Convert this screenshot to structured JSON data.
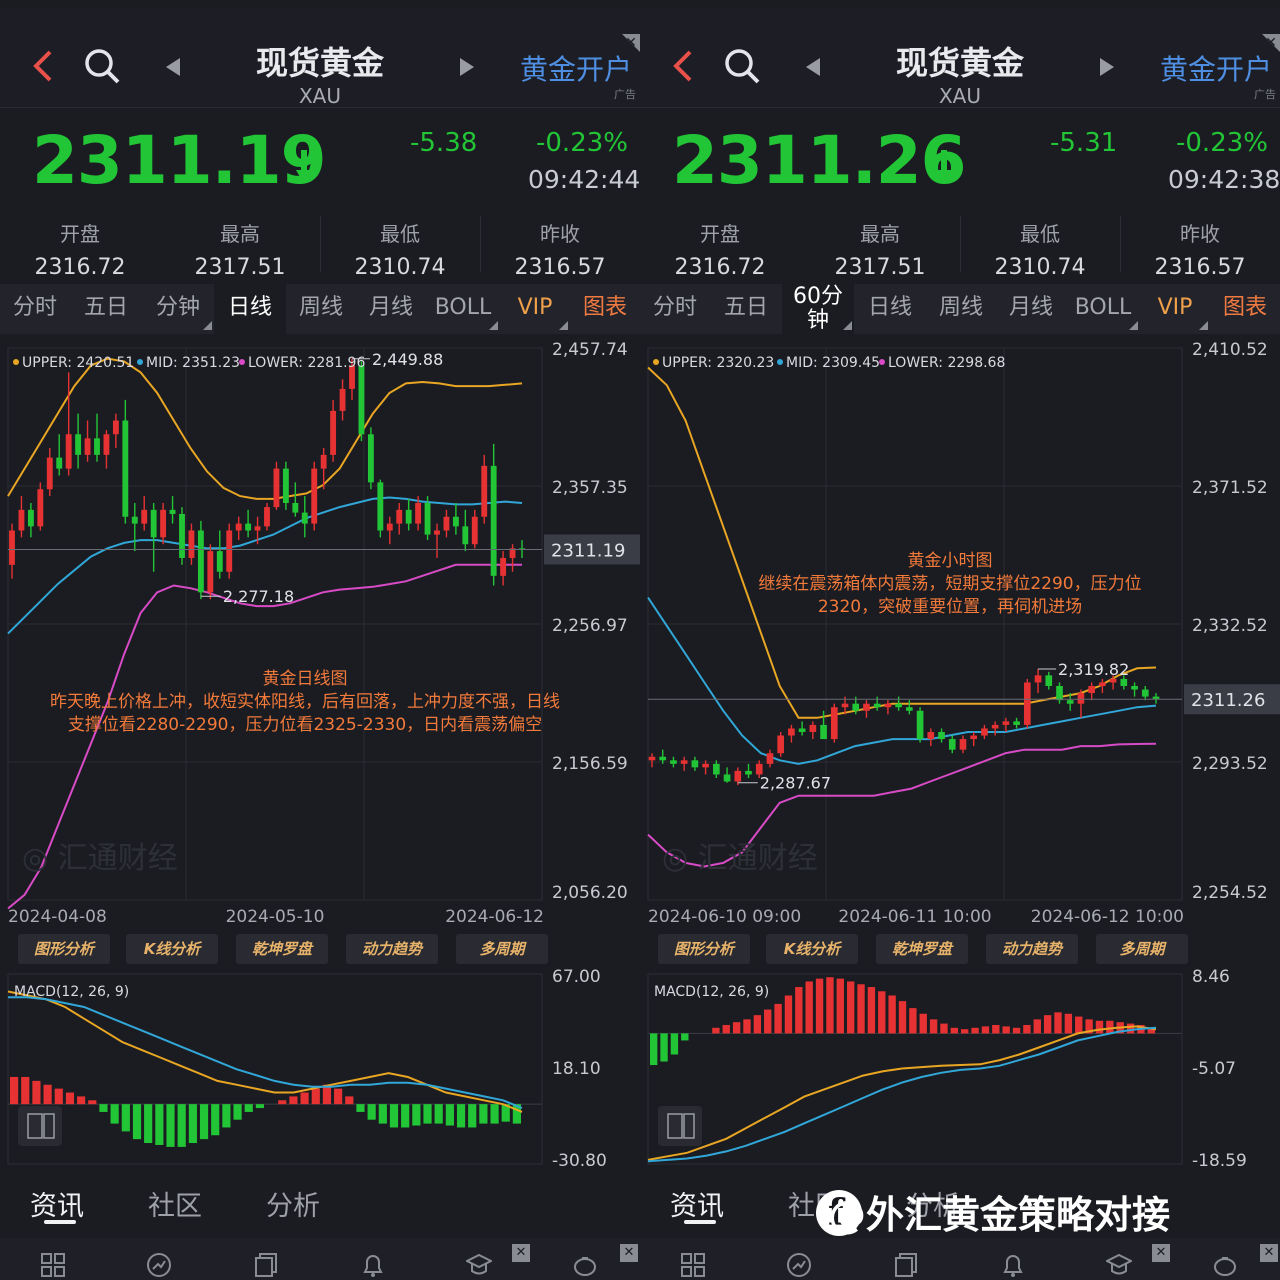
{
  "panels": [
    {
      "header": {
        "title": "现货黄金",
        "symbol": "XAU",
        "open_account": "黄金开户",
        "ad_tag": "广告",
        "close_glyph": "✕"
      },
      "quote": {
        "price": "2311.19",
        "change": "-5.38",
        "change_pct": "-0.23%",
        "time": "09:42:44"
      },
      "stats": [
        {
          "label": "开盘",
          "value": "2316.72"
        },
        {
          "label": "最高",
          "value": "2317.51"
        },
        {
          "label": "最低",
          "value": "2310.74"
        },
        {
          "label": "昨收",
          "value": "2316.57"
        }
      ],
      "tabs": [
        "分时",
        "五日",
        "分钟",
        "日线",
        "周线",
        "月线",
        "BOLL",
        "VIP",
        "图表"
      ],
      "active_tab": "日线",
      "indicator_buttons": [
        "图形分析",
        "K线分析",
        "乾坤罗盘",
        "动力趋势",
        "多周期"
      ],
      "nav": [
        "资讯",
        "社区",
        "分析"
      ],
      "annotation": {
        "title": "黄金日线图",
        "lines": [
          "昨天晚上价格上冲，收短实体阳线，后有回落，上冲力度不强，日线",
          "支撑位看2280-2290，压力位看2325-2330，日内看震荡偏空"
        ]
      },
      "watermark_text": "汇通财经"
    },
    {
      "header": {
        "title": "现货黄金",
        "symbol": "XAU",
        "open_account": "黄金开户",
        "ad_tag": "广告",
        "close_glyph": "✕"
      },
      "quote": {
        "price": "2311.26",
        "change": "-5.31",
        "change_pct": "-0.23%",
        "time": "09:42:38"
      },
      "stats": [
        {
          "label": "开盘",
          "value": "2316.72"
        },
        {
          "label": "最高",
          "value": "2317.51"
        },
        {
          "label": "最低",
          "value": "2310.74"
        },
        {
          "label": "昨收",
          "value": "2316.57"
        }
      ],
      "tabs": [
        "分时",
        "五日",
        "60分钟",
        "日线",
        "周线",
        "月线",
        "BOLL",
        "VIP",
        "图表"
      ],
      "tab_60_line1": "60分",
      "tab_60_line2": "钟",
      "active_tab": "60分钟",
      "indicator_buttons": [
        "图形分析",
        "K线分析",
        "乾坤罗盘",
        "动力趋势",
        "多周期"
      ],
      "nav": [
        "资讯",
        "社区",
        "分析"
      ],
      "annotation": {
        "title": "黄金小时图",
        "lines": [
          "继续在震荡箱体内震荡，短期支撑位2290，压力位",
          "2320，突破重要位置，再伺机进场"
        ]
      },
      "watermark_text": "汇通财经"
    }
  ],
  "footer_watermark": "@外汇黄金策略对接",
  "colors": {
    "up": "#e63232",
    "down": "#22c536",
    "upper": "#e8a623",
    "mid": "#31a7d8",
    "lower": "#d84bc6",
    "annotation": "#f27a3a",
    "link": "#4e8fe3"
  },
  "dock_icons": [
    "grid-icon",
    "compass-icon",
    "news-icon",
    "bell-icon",
    "mortarboard-icon",
    "piggy-bank-icon"
  ],
  "chart_data": [
    {
      "type": "candlestick",
      "title": "",
      "indicator": "BOLL",
      "legend": {
        "upper": "UPPER: 2420.51",
        "mid": "MID: 2351.23",
        "lower": "LOWER: 2281.96"
      },
      "y_ticks": [
        "2,457.74",
        "2,357.35",
        "2,256.97",
        "2,156.59",
        "2,056.20"
      ],
      "ylim": [
        2056.2,
        2457.74
      ],
      "x_ticks": [
        "2024-04-08",
        "2024-05-10",
        "2024-06-12"
      ],
      "current_price_label": "2311.19",
      "current_price": 2311.19,
      "high_label": "2,449.88",
      "high": 2449.88,
      "low_label": "2,277.18",
      "low": 2277.18,
      "ohlc": [
        [
          2300,
          2330,
          2290,
          2325
        ],
        [
          2325,
          2350,
          2320,
          2340
        ],
        [
          2340,
          2345,
          2320,
          2328
        ],
        [
          2328,
          2360,
          2325,
          2355
        ],
        [
          2355,
          2385,
          2350,
          2378
        ],
        [
          2378,
          2395,
          2365,
          2370
        ],
        [
          2370,
          2440,
          2365,
          2395
        ],
        [
          2395,
          2410,
          2370,
          2380
        ],
        [
          2380,
          2405,
          2375,
          2392
        ],
        [
          2392,
          2410,
          2375,
          2380
        ],
        [
          2380,
          2398,
          2370,
          2395
        ],
        [
          2395,
          2410,
          2385,
          2405
        ],
        [
          2405,
          2420,
          2330,
          2335
        ],
        [
          2335,
          2345,
          2310,
          2330
        ],
        [
          2330,
          2350,
          2325,
          2340
        ],
        [
          2340,
          2345,
          2295,
          2320
        ],
        [
          2320,
          2345,
          2315,
          2340
        ],
        [
          2340,
          2350,
          2330,
          2337
        ],
        [
          2337,
          2342,
          2300,
          2305
        ],
        [
          2305,
          2330,
          2300,
          2325
        ],
        [
          2325,
          2332,
          2275,
          2280
        ],
        [
          2280,
          2315,
          2275,
          2310
        ],
        [
          2310,
          2325,
          2290,
          2295
        ],
        [
          2295,
          2330,
          2290,
          2325
        ],
        [
          2325,
          2335,
          2318,
          2330
        ],
        [
          2330,
          2340,
          2320,
          2325
        ],
        [
          2325,
          2335,
          2315,
          2328
        ],
        [
          2328,
          2345,
          2325,
          2342
        ],
        [
          2342,
          2375,
          2340,
          2370
        ],
        [
          2370,
          2375,
          2340,
          2345
        ],
        [
          2345,
          2360,
          2335,
          2338
        ],
        [
          2338,
          2350,
          2320,
          2330
        ],
        [
          2330,
          2375,
          2325,
          2370
        ],
        [
          2370,
          2385,
          2355,
          2380
        ],
        [
          2380,
          2420,
          2375,
          2412
        ],
        [
          2412,
          2435,
          2405,
          2428
        ],
        [
          2428,
          2450,
          2420,
          2445
        ],
        [
          2445,
          2448,
          2390,
          2395
        ],
        [
          2395,
          2400,
          2355,
          2360
        ],
        [
          2360,
          2362,
          2320,
          2325
        ],
        [
          2325,
          2335,
          2315,
          2330
        ],
        [
          2330,
          2345,
          2322,
          2340
        ],
        [
          2340,
          2348,
          2325,
          2330
        ],
        [
          2330,
          2350,
          2325,
          2345
        ],
        [
          2345,
          2350,
          2318,
          2322
        ],
        [
          2322,
          2330,
          2305,
          2325
        ],
        [
          2325,
          2340,
          2320,
          2335
        ],
        [
          2335,
          2345,
          2322,
          2328
        ],
        [
          2328,
          2340,
          2310,
          2315
        ],
        [
          2315,
          2340,
          2312,
          2335
        ],
        [
          2335,
          2380,
          2330,
          2372
        ],
        [
          2372,
          2388,
          2285,
          2292
        ],
        [
          2292,
          2310,
          2285,
          2305
        ],
        [
          2305,
          2315,
          2295,
          2312
        ],
        [
          2312,
          2318,
          2305,
          2311
        ]
      ],
      "boll_upper": [
        2350,
        2370,
        2390,
        2410,
        2430,
        2445,
        2450,
        2448,
        2440,
        2425,
        2405,
        2385,
        2368,
        2356,
        2350,
        2348,
        2348,
        2350,
        2352,
        2358,
        2370,
        2390,
        2410,
        2425,
        2432,
        2433,
        2432,
        2430,
        2430,
        2430,
        2431,
        2432
      ],
      "boll_mid": [
        2250,
        2262,
        2274,
        2286,
        2296,
        2306,
        2312,
        2316,
        2318,
        2318,
        2316,
        2314,
        2312,
        2312,
        2314,
        2318,
        2322,
        2328,
        2334,
        2338,
        2342,
        2345,
        2348,
        2349,
        2348,
        2346,
        2345,
        2344,
        2344,
        2345,
        2346,
        2345
      ],
      "boll_lower": [
        2050,
        2060,
        2080,
        2110,
        2140,
        2170,
        2200,
        2235,
        2265,
        2280,
        2285,
        2283,
        2280,
        2276,
        2272,
        2270,
        2270,
        2272,
        2276,
        2280,
        2282,
        2283,
        2284,
        2286,
        2288,
        2292,
        2296,
        2300,
        2300,
        2300,
        2300,
        2300
      ]
    },
    {
      "type": "candlestick",
      "title": "",
      "indicator": "BOLL",
      "legend": {
        "upper": "UPPER: 2320.23",
        "mid": "MID: 2309.45",
        "lower": "LOWER: 2298.68"
      },
      "y_ticks": [
        "2,410.52",
        "2,371.52",
        "2,332.52",
        "2,293.52",
        "2,254.52"
      ],
      "ylim": [
        2254.52,
        2410.52
      ],
      "x_ticks": [
        "2024-06-10 09:00",
        "2024-06-11 10:00",
        "2024-06-12 10:00"
      ],
      "current_price_label": "2311.26",
      "current_price": 2311.26,
      "high_label": "2,319.82",
      "high": 2319.82,
      "low_label": "2,287.67",
      "low": 2287.67,
      "ohlc": [
        [
          2294,
          2296,
          2292,
          2295
        ],
        [
          2295,
          2297,
          2293,
          2294
        ],
        [
          2294,
          2295,
          2292,
          2293
        ],
        [
          2293,
          2295,
          2291,
          2294
        ],
        [
          2294,
          2295,
          2291,
          2292
        ],
        [
          2292,
          2294,
          2290,
          2293
        ],
        [
          2293,
          2294,
          2289,
          2290
        ],
        [
          2290,
          2292,
          2287.67,
          2288
        ],
        [
          2288,
          2292,
          2287,
          2291
        ],
        [
          2291,
          2293,
          2289,
          2290
        ],
        [
          2290,
          2294,
          2289,
          2293
        ],
        [
          2293,
          2297,
          2292,
          2296
        ],
        [
          2296,
          2302,
          2295,
          2301
        ],
        [
          2301,
          2304,
          2299,
          2303
        ],
        [
          2303,
          2305,
          2301,
          2302
        ],
        [
          2302,
          2305,
          2300,
          2304
        ],
        [
          2304,
          2308,
          2303,
          2300
        ],
        [
          2300,
          2310,
          2299,
          2309
        ],
        [
          2309,
          2312,
          2307,
          2310
        ],
        [
          2310,
          2312,
          2307,
          2308
        ],
        [
          2308,
          2311,
          2306,
          2310
        ],
        [
          2310,
          2312,
          2308,
          2309
        ],
        [
          2309,
          2311,
          2307,
          2310
        ],
        [
          2310,
          2312,
          2308,
          2309
        ],
        [
          2309,
          2311,
          2307,
          2308
        ],
        [
          2308,
          2309,
          2299,
          2300
        ],
        [
          2300,
          2303,
          2298,
          2302
        ],
        [
          2302,
          2303,
          2299,
          2300
        ],
        [
          2300,
          2301,
          2296,
          2297
        ],
        [
          2297,
          2301,
          2296,
          2300
        ],
        [
          2300,
          2302,
          2298,
          2301
        ],
        [
          2301,
          2304,
          2300,
          2303
        ],
        [
          2303,
          2305,
          2301,
          2304
        ],
        [
          2304,
          2306,
          2302,
          2305
        ],
        [
          2305,
          2306,
          2303,
          2304
        ],
        [
          2304,
          2317,
          2303,
          2316
        ],
        [
          2316,
          2319.82,
          2313,
          2318
        ],
        [
          2318,
          2319,
          2314,
          2315
        ],
        [
          2315,
          2316,
          2310,
          2311
        ],
        [
          2311,
          2313,
          2308,
          2310
        ],
        [
          2310,
          2314,
          2306,
          2313
        ],
        [
          2313,
          2316,
          2311,
          2315
        ],
        [
          2315,
          2317,
          2313,
          2316
        ],
        [
          2316,
          2318,
          2314,
          2317
        ],
        [
          2317,
          2318,
          2314,
          2315
        ],
        [
          2315,
          2316,
          2312,
          2314
        ],
        [
          2314,
          2315,
          2311,
          2312
        ],
        [
          2312,
          2313,
          2310,
          2311.26
        ]
      ],
      "boll_upper": [
        2405,
        2400,
        2390,
        2375,
        2360,
        2345,
        2330,
        2315,
        2306,
        2306,
        2307,
        2308,
        2309,
        2310,
        2310,
        2310,
        2310,
        2310,
        2310,
        2310,
        2310,
        2311,
        2312,
        2313,
        2315,
        2318,
        2320,
        2320.23
      ],
      "boll_mid": [
        2340,
        2332,
        2324,
        2316,
        2308,
        2301,
        2296,
        2294,
        2293,
        2294,
        2296,
        2298,
        2299,
        2300,
        2300,
        2300,
        2301,
        2302,
        2302,
        2302,
        2303,
        2304,
        2305,
        2306,
        2307,
        2308,
        2309,
        2309.45
      ],
      "boll_lower": [
        2273,
        2268,
        2265,
        2264,
        2265,
        2268,
        2275,
        2282,
        2284,
        2284,
        2284,
        2284,
        2284,
        2285,
        2286,
        2288,
        2290,
        2292,
        2294,
        2296,
        2297,
        2297,
        2297,
        2298,
        2298,
        2298.5,
        2298.6,
        2298.68
      ]
    },
    {
      "type": "bar",
      "title": "",
      "indicator": "MACD",
      "legend": "MACD(12, 26, 9)",
      "y_ticks": [
        "67.00",
        "18.10",
        "-30.80"
      ],
      "ylim": [
        -30.8,
        67.0
      ],
      "histogram": [
        14,
        14,
        12,
        10,
        8,
        6,
        4,
        2,
        -4,
        -10,
        -14,
        -18,
        -20,
        -21,
        -22,
        -22,
        -20,
        -18,
        -16,
        -12,
        -8,
        -4,
        -2,
        0,
        2,
        4,
        6,
        8,
        10,
        8,
        4,
        -4,
        -8,
        -10,
        -12,
        -12,
        -11,
        -10,
        -10,
        -11,
        -12,
        -12,
        -10,
        -10,
        -9,
        -10
      ],
      "dif": [
        58,
        56,
        54,
        50,
        44,
        38,
        32,
        28,
        24,
        20,
        16,
        12,
        10,
        8,
        6,
        6,
        8,
        10,
        12,
        14,
        16,
        14,
        10,
        6,
        4,
        2,
        0,
        -4
      ],
      "dea": [
        55,
        55,
        54,
        52,
        50,
        46,
        42,
        38,
        34,
        30,
        26,
        22,
        18,
        15,
        12,
        10,
        9,
        9,
        10,
        10,
        11,
        11,
        10,
        8,
        6,
        4,
        2,
        -2
      ]
    },
    {
      "type": "bar",
      "title": "",
      "indicator": "MACD",
      "legend": "MACD(12, 26, 9)",
      "y_ticks": [
        "8.46",
        "-5.07",
        "-18.59"
      ],
      "ylim": [
        -18.59,
        8.46
      ],
      "histogram": [
        -4.5,
        -4,
        -3,
        -1,
        0,
        0,
        0.8,
        1.2,
        1.6,
        2,
        2.6,
        3.4,
        4.2,
        5.4,
        6.6,
        7.4,
        7.8,
        8,
        7.8,
        7.4,
        7,
        6.6,
        6,
        5.4,
        4.6,
        3.6,
        2.8,
        2,
        1.4,
        0.8,
        0.6,
        0.8,
        1,
        1.2,
        1,
        0.8,
        1.2,
        2,
        2.6,
        3,
        2.8,
        2.4,
        2,
        1.8,
        1.8,
        1.6,
        1.4,
        1.2,
        0.6
      ],
      "dif": [
        -18,
        -17.5,
        -17,
        -16,
        -15,
        -13.5,
        -12,
        -10.5,
        -9,
        -8,
        -7,
        -6,
        -5.4,
        -5,
        -4.8,
        -4.6,
        -4.5,
        -4.4,
        -3.8,
        -3,
        -2,
        -1,
        0,
        0.5,
        0.8,
        1,
        0.6
      ],
      "dea": [
        -18.2,
        -18,
        -17.8,
        -17.4,
        -16.8,
        -16,
        -15,
        -14,
        -12.8,
        -11.6,
        -10.4,
        -9.2,
        -8,
        -7,
        -6.2,
        -5.6,
        -5.2,
        -5,
        -4.6,
        -3.8,
        -3,
        -2,
        -1,
        -0.4,
        0.2,
        0.6,
        0.8
      ]
    }
  ]
}
